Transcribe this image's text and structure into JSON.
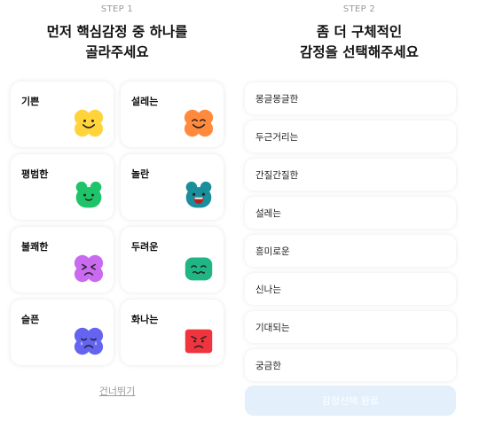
{
  "left": {
    "step": "STEP 1",
    "title_line1": "먼저 핵심감정 중 하나를",
    "title_line2": "골라주세요",
    "emotions": [
      {
        "label": "기쁜",
        "color": "#ffd43b",
        "icon": "happy-face-icon"
      },
      {
        "label": "설레는",
        "color": "#ff8a3d",
        "icon": "excited-face-icon"
      },
      {
        "label": "평범한",
        "color": "#1fc46a",
        "icon": "calm-face-icon"
      },
      {
        "label": "놀란",
        "color": "#1b8e9c",
        "icon": "surprised-face-icon"
      },
      {
        "label": "불쾌한",
        "color": "#c96af0",
        "icon": "displeased-face-icon"
      },
      {
        "label": "두려운",
        "color": "#1fb584",
        "icon": "scared-face-icon"
      },
      {
        "label": "슬픈",
        "color": "#6464f0",
        "icon": "sad-face-icon"
      },
      {
        "label": "화나는",
        "color": "#f0343e",
        "icon": "angry-face-icon"
      }
    ],
    "skip_label": "건너뛰기"
  },
  "right": {
    "step": "STEP 2",
    "title_line1": "좀 더 구체적인",
    "title_line2": "감정을 선택해주세요",
    "options": [
      "몽글몽글한",
      "두근거리는",
      "간질간질한",
      "설레는",
      "흥미로운",
      "신나는",
      "기대되는",
      "궁금한"
    ],
    "complete_label": "감정선택 완료",
    "complete_bg": "#e3effb"
  }
}
